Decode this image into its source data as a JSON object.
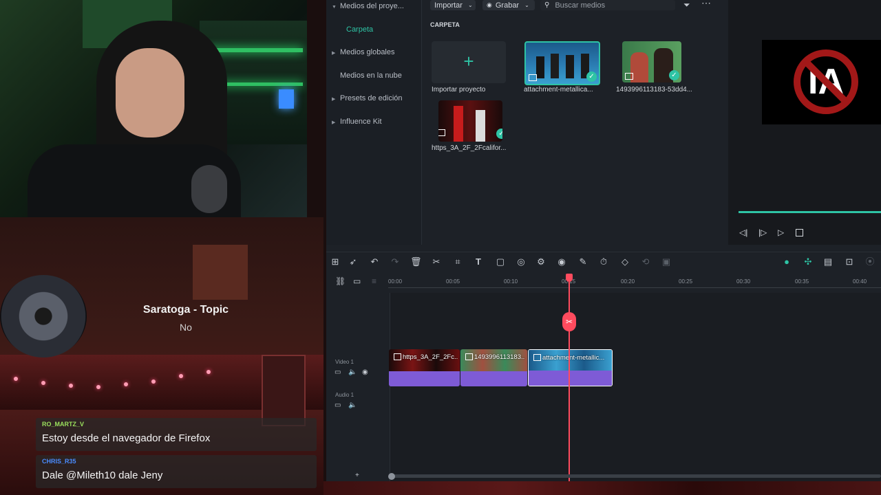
{
  "editor": {
    "toolbar": {
      "import_label": "Importar",
      "record_label": "Grabar",
      "search_placeholder": "Buscar medios"
    },
    "sidebar": {
      "items": [
        {
          "label": "Medios del proye...",
          "chevron": true
        },
        {
          "label": "Carpeta",
          "chevron": false
        },
        {
          "label": "Medios globales",
          "chevron": true
        },
        {
          "label": "Medios en la nube",
          "chevron": false
        },
        {
          "label": "Presets de edición",
          "chevron": true
        },
        {
          "label": "Influence Kit",
          "chevron": true
        }
      ]
    },
    "media": {
      "section_title": "CARPETA",
      "items": [
        {
          "label": "Importar proyecto"
        },
        {
          "label": "attachment-metallica..."
        },
        {
          "label": "1493996113183-53dd4..."
        },
        {
          "label": "https_3A_2F_2Fcalifor..."
        }
      ]
    },
    "timeline": {
      "ruler": [
        "00:00",
        "00:05",
        "00:10",
        "00:15",
        "00:20",
        "00:25",
        "00:30",
        "00:35",
        "00:40"
      ],
      "tracks": [
        {
          "label": "Video 1"
        },
        {
          "label": "Audio 1"
        }
      ],
      "clips": [
        {
          "label": "https_3A_2F_2Fc..."
        },
        {
          "label": "1493996113183..."
        },
        {
          "label": "attachment-metallic..."
        }
      ],
      "colors": {
        "accent": "#2ec4a5",
        "playhead": "#ff4b5e",
        "clip_bar": "#7e5bd6"
      }
    }
  },
  "music": {
    "artist": "Saratoga - Topic",
    "track": "No"
  },
  "chat": [
    {
      "user": "RO_MARTZ_V",
      "message": "Estoy desde el navegador de Firefox",
      "user_color": "#9be15d"
    },
    {
      "user": "CHRIS_R35",
      "message": "Dale @Mileth10 dale Jeny",
      "user_color": "#4a8cff"
    }
  ]
}
